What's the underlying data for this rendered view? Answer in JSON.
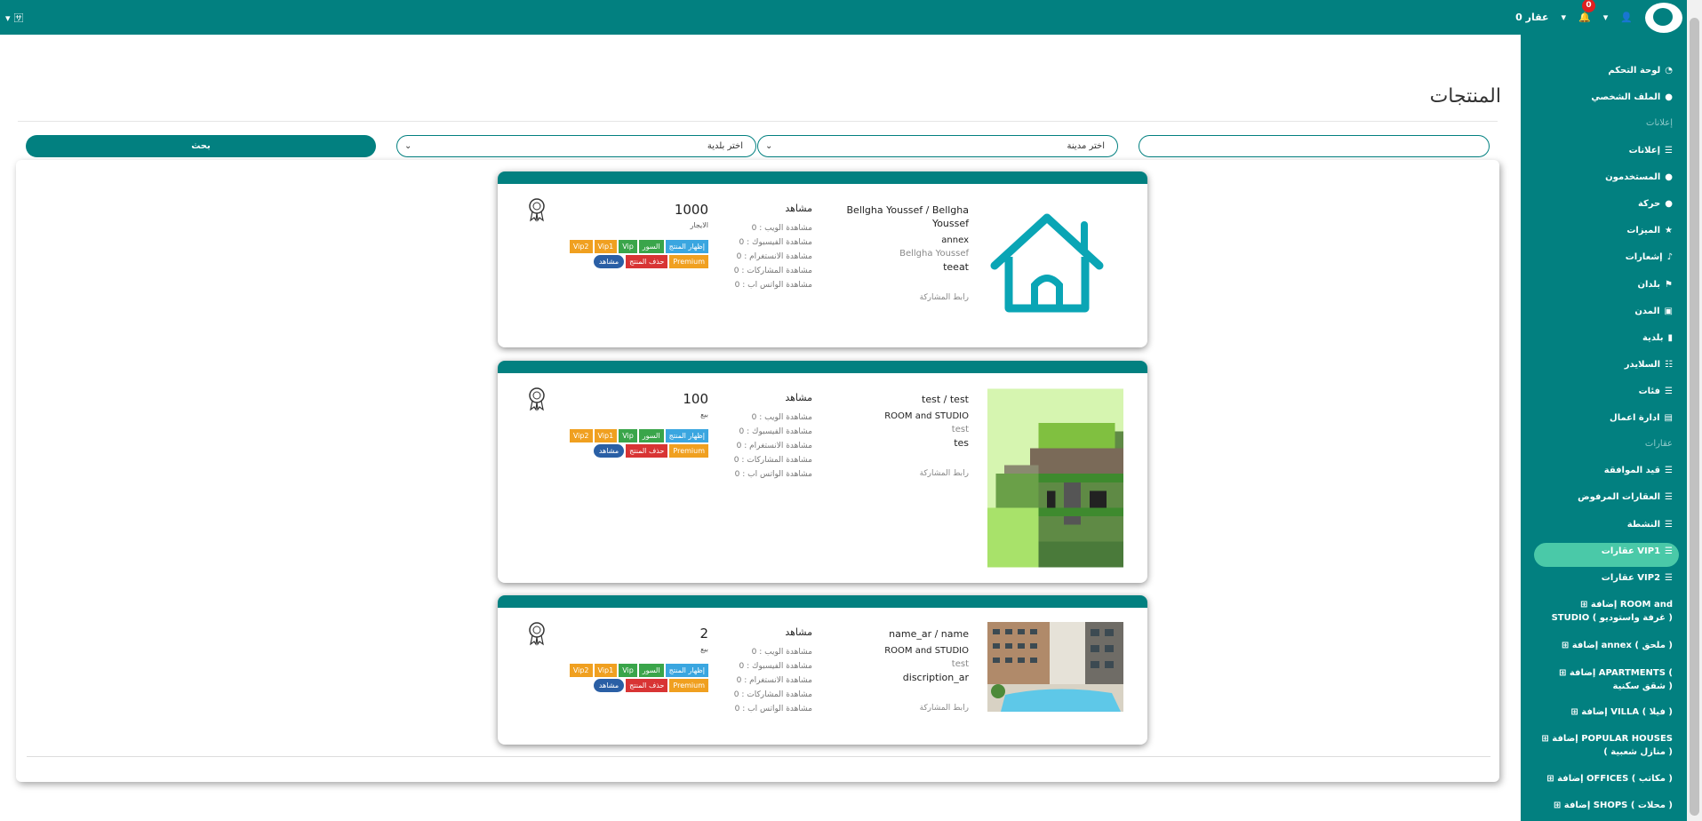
{
  "topbar": {
    "lang_icon": "language-icon",
    "realty_label": "عقار 0",
    "notifications_count": "0",
    "user_icon": "user-icon"
  },
  "page": {
    "title": "المنتجات",
    "search": {
      "city_placeholder": "اختر مدينة",
      "municipality_placeholder": "اختر بلدية",
      "button_label": "بحث"
    }
  },
  "sidebar": {
    "items": [
      {
        "label": "لوحة التحكم",
        "icon": "dashboard-icon"
      },
      {
        "label": "الملف الشخصي",
        "icon": "user-icon"
      },
      {
        "label": "إعلانات",
        "icon": "list-icon"
      },
      {
        "label": "المستخدمون",
        "icon": "users-icon"
      },
      {
        "label": "حركة",
        "icon": "users-icon"
      },
      {
        "label": "الميزات",
        "icon": "star-icon"
      },
      {
        "label": "إشعارات",
        "icon": "bell-icon"
      },
      {
        "label": "بلدان",
        "icon": "flag-icon"
      },
      {
        "label": "المدن",
        "icon": "building-icon"
      },
      {
        "label": "بلدية",
        "icon": "building-icon"
      },
      {
        "label": "السلايدر",
        "icon": "sliders-icon"
      },
      {
        "label": "فئات",
        "icon": "list-icon"
      },
      {
        "label": "ادارة اعمال",
        "icon": "briefcase-icon"
      },
      {
        "label": "قيد الموافقة",
        "icon": "list-icon"
      },
      {
        "label": "العقارات المرفوض",
        "icon": "list-icon"
      },
      {
        "label": "النشطة",
        "icon": "list-icon"
      },
      {
        "label": "عقارات VIP1",
        "icon": "list-icon"
      },
      {
        "label": "عقارات VIP2",
        "icon": "list-icon"
      }
    ],
    "sections": {
      "ads": "إعلانات",
      "properties": "عقارات"
    },
    "add_items": [
      {
        "label": "إضافة ROOM and STUDIO ( غرفة واستوديو )"
      },
      {
        "label": "إضافة annex ( ملحق )"
      },
      {
        "label": "إضافة APARTMENTS ( شقق سكنية )"
      },
      {
        "label": "إضافة VILLA ( فيلا )"
      },
      {
        "label": "إضافة POPULAR HOUSES ( منازل شعبية )"
      },
      {
        "label": "إضافة OFFICES ( مكاتب )"
      },
      {
        "label": "إضافة SHOPS ( محلات )"
      }
    ]
  },
  "cards": [
    {
      "title": "Bellgha Youssef / Bellgha Youssef",
      "category": "annex",
      "owner": "Bellgha Youssef",
      "description": "teeat",
      "share_link": "رابط المشاركة",
      "views_header": "مشاهد",
      "stats": [
        "مشاهدة الويب : 0",
        "مشاهدة الفيسبوك : 0",
        "مشاهدة الانستغرام : 0",
        "مشاهدة المشاركات : 0",
        "مشاهدة الواتس اب : 0"
      ],
      "price": "1000",
      "deal_type": "الايجار",
      "image": "house-icon"
    },
    {
      "title": "test / test",
      "category": "ROOM and STUDIO",
      "owner": "test",
      "description": "tes",
      "share_link": "رابط المشاركة",
      "views_header": "مشاهد",
      "stats": [
        "مشاهدة الويب : 0",
        "مشاهدة الفيسبوك : 0",
        "مشاهدة الانستغرام : 0",
        "مشاهدة المشاركات : 0",
        "مشاهدة الواتس اب : 0"
      ],
      "price": "100",
      "deal_type": "بيع",
      "image": "pixel-house-image"
    },
    {
      "title": "name_ar / name",
      "category": "ROOM and STUDIO",
      "owner": "test",
      "description": "discription_ar",
      "share_link": "رابط المشاركة",
      "views_header": "مشاهد",
      "stats": [
        "مشاهدة الويب : 0",
        "مشاهدة الفيسبوك : 0",
        "مشاهدة الانستغرام : 0",
        "مشاهدة المشاركات : 0",
        "مشاهدة الواتس اب : 0"
      ],
      "price": "2",
      "deal_type": "بيع",
      "image": "apartment-pool-photo"
    }
  ],
  "card_buttons": {
    "show": "إظهار المنتج",
    "soor": "السور",
    "vip": "Vip",
    "vip1": "Vip1",
    "vip2": "Vip2",
    "premium": "Premium",
    "delete": "حذف المنتج",
    "views": "مشاهد"
  },
  "colors": {
    "primary": "#028080",
    "active": "#4ac9a8",
    "blue": "#3aa6e0",
    "green": "#3aa54a",
    "orange": "#f0a020",
    "red": "#d83434",
    "navy": "#2a5fa5"
  }
}
